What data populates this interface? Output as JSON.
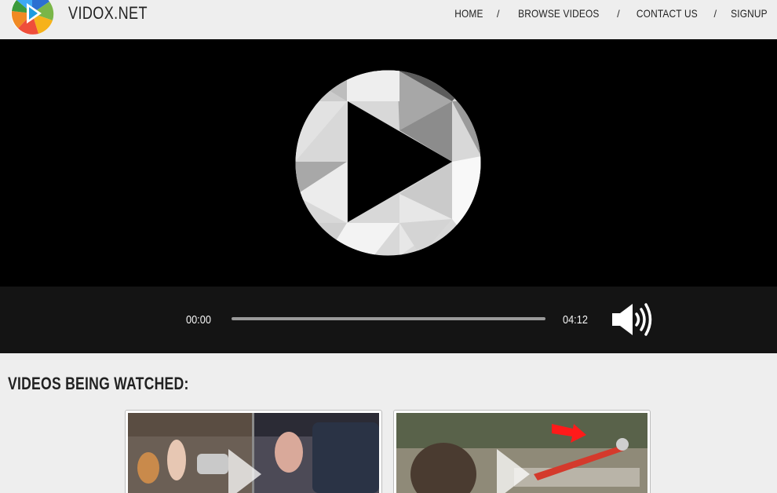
{
  "header": {
    "brand": "VIDOX.NET",
    "logo_icon": "vidox-logo-icon",
    "nav": [
      {
        "label": "HOME"
      },
      {
        "label": "BROWSE VIDEOS"
      },
      {
        "label": "CONTACT US"
      },
      {
        "label": "SIGNUP"
      }
    ],
    "separator": "/"
  },
  "player": {
    "current_time": "00:00",
    "duration": "04:12",
    "progress_fraction": 0,
    "play_icon": "play-icon",
    "volume_icon": "volume-icon"
  },
  "section": {
    "title": "VIDEOS BEING WATCHED:"
  },
  "videos": [
    {
      "thumbnail_icon": "play-icon"
    },
    {
      "thumbnail_icon": "play-icon"
    }
  ],
  "colors": {
    "background": "#eeeeee",
    "player_bg": "#000000",
    "controls_bg": "#141414",
    "progress_track": "#9a9a9a"
  }
}
